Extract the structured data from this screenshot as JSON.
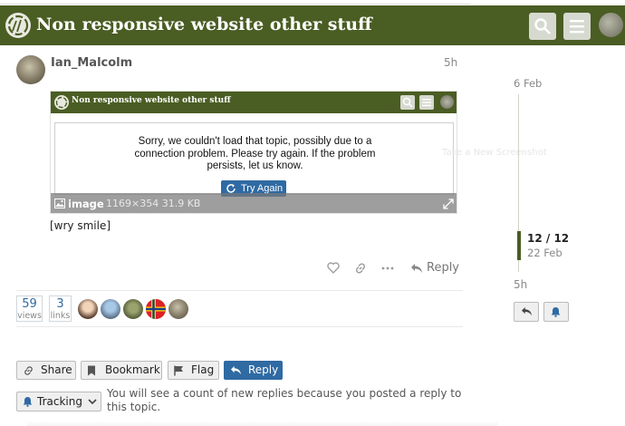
{
  "header": {
    "title": "Non responsive website other stuff",
    "search_icon": "search-icon",
    "menu_icon": "hamburger-menu-icon",
    "brand_color": "#4a5d23"
  },
  "post": {
    "username": "Ian_Malcolm",
    "age": "5h",
    "text": "[wry smile]",
    "reply_label": "Reply"
  },
  "embed": {
    "title": "Non responsive website other stuff",
    "message": "Sorry, we couldn't load that topic, possibly due to a connection problem. Please try again. If the problem persists, let us know.",
    "try_again": "Try Again",
    "ghost_text": "Take a New Screenshot",
    "image_label": "image",
    "image_dims": "1169×354 31.9 KB"
  },
  "stats": {
    "views_num": "59",
    "views_label": "views",
    "links_num": "3",
    "links_label": "links"
  },
  "footer": {
    "share": "Share",
    "bookmark": "Bookmark",
    "flag": "Flag",
    "reply": "Reply",
    "tracking": "Tracking",
    "notification_text": "You will see a count of new replies because you posted a reply to this topic."
  },
  "timeline": {
    "start_date": "6 Feb",
    "position": "12 / 12",
    "current_date": "22 Feb",
    "last_age": "5h"
  },
  "colors": {
    "accent": "#2f6aa3",
    "muted": "#888888"
  }
}
